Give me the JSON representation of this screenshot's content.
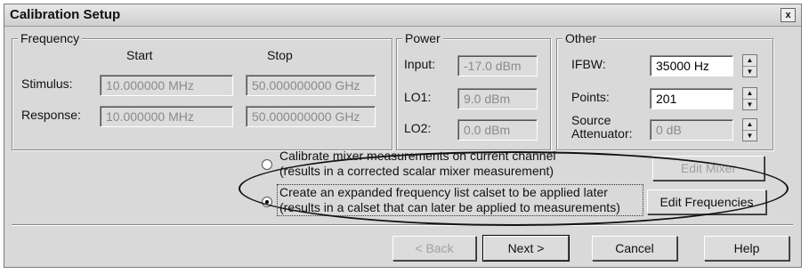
{
  "window": {
    "title": "Calibration Setup",
    "close": "x"
  },
  "frequency": {
    "group_label": "Frequency",
    "start_header": "Start",
    "stop_header": "Stop",
    "stimulus_label": "Stimulus:",
    "response_label": "Response:",
    "stimulus_start": "10.000000 MHz",
    "stimulus_stop": "50.000000000 GHz",
    "response_start": "10.000000 MHz",
    "response_stop": "50.000000000 GHz"
  },
  "power": {
    "group_label": "Power",
    "input_label": "Input:",
    "input_value": "-17.0 dBm",
    "lo1_label": "LO1:",
    "lo1_value": "9.0 dBm",
    "lo2_label": "LO2:",
    "lo2_value": "0.0 dBm"
  },
  "other": {
    "group_label": "Other",
    "ifbw_label": "IFBW:",
    "ifbw_value": "35000 Hz",
    "points_label": "Points:",
    "points_value": "201",
    "atten_label_1": "Source",
    "atten_label_2": "Attenuator:",
    "atten_value": "0 dB"
  },
  "options": {
    "opt1_line1": "Calibrate mixer measurements on current channel",
    "opt1_line2": "(results in a corrected scalar mixer measurement)",
    "opt2_line1": "Create an expanded frequency list calset to be applied later",
    "opt2_line2": "(results in a calset that can later be applied to measurements)",
    "selected": 2
  },
  "buttons": {
    "edit_mixer": "Edit Mixer",
    "edit_frequencies": "Edit Frequencies",
    "back": "< Back",
    "next": "Next >",
    "cancel": "Cancel",
    "help": "Help"
  }
}
